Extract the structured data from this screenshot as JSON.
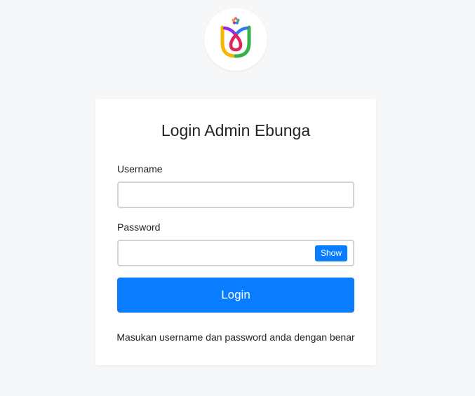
{
  "brand": {
    "logo_icon": "tulip-logo-icon",
    "colors": {
      "accent": "#0a7cff",
      "background": "#f6f7f9",
      "card": "#ffffff"
    }
  },
  "login_card": {
    "title": "Login Admin Ebunga",
    "username": {
      "label": "Username",
      "value": "",
      "placeholder": ""
    },
    "password": {
      "label": "Password",
      "value": "",
      "placeholder": "",
      "show_label": "Show"
    },
    "submit_label": "Login",
    "hint": "Masukan username dan password anda dengan benar"
  }
}
